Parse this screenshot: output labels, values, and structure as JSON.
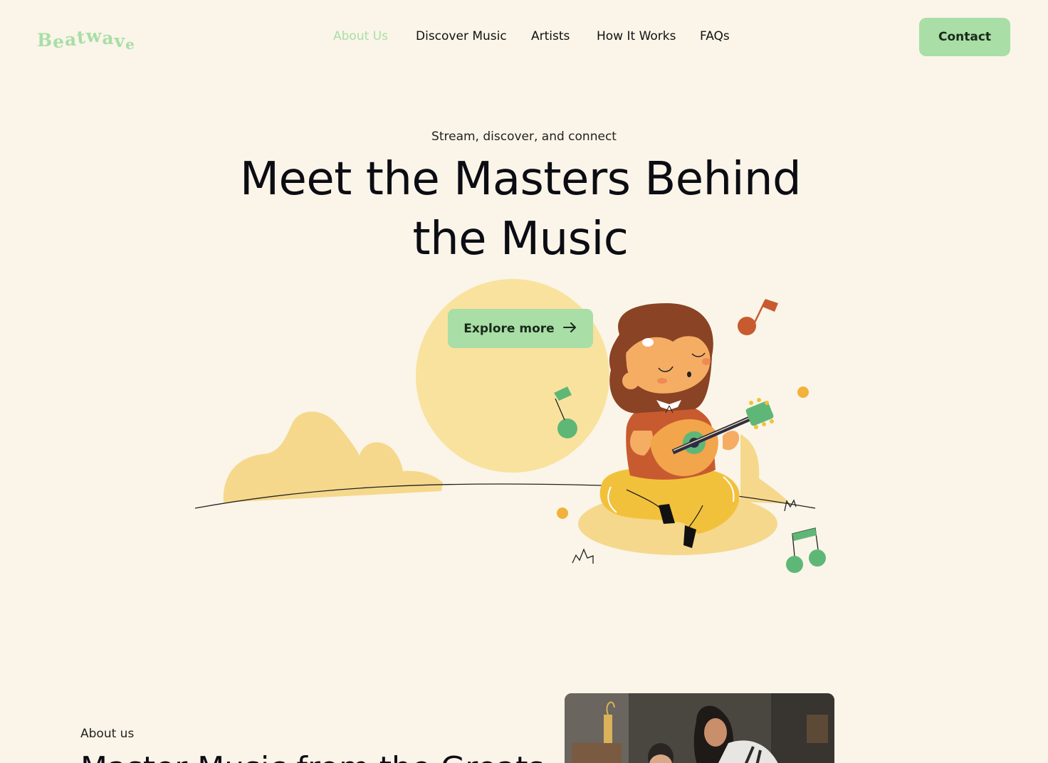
{
  "header": {
    "logo_letters": [
      "B",
      "e",
      "a",
      "t",
      "w",
      "a",
      "v",
      "e"
    ],
    "nav": [
      {
        "label": "About Us",
        "active": true
      },
      {
        "label": "Discover Music",
        "active": false
      },
      {
        "label": "Artists",
        "active": false
      },
      {
        "label": "How It Works",
        "active": false
      },
      {
        "label": "FAQs",
        "active": false
      }
    ],
    "contact_label": "Contact"
  },
  "hero": {
    "eyebrow": "Stream, discover, and connect",
    "title_line1": "Meet the Masters Behind",
    "title_line2": "the Music",
    "cta_label": "Explore more",
    "cta_icon": "arrow-right-icon"
  },
  "about": {
    "label": "About us",
    "title": "Master Music from the Greats"
  },
  "colors": {
    "background": "#faf5e8",
    "accent": "#a9dea6",
    "sun": "#f9e29d",
    "text": "#0c0c14"
  }
}
